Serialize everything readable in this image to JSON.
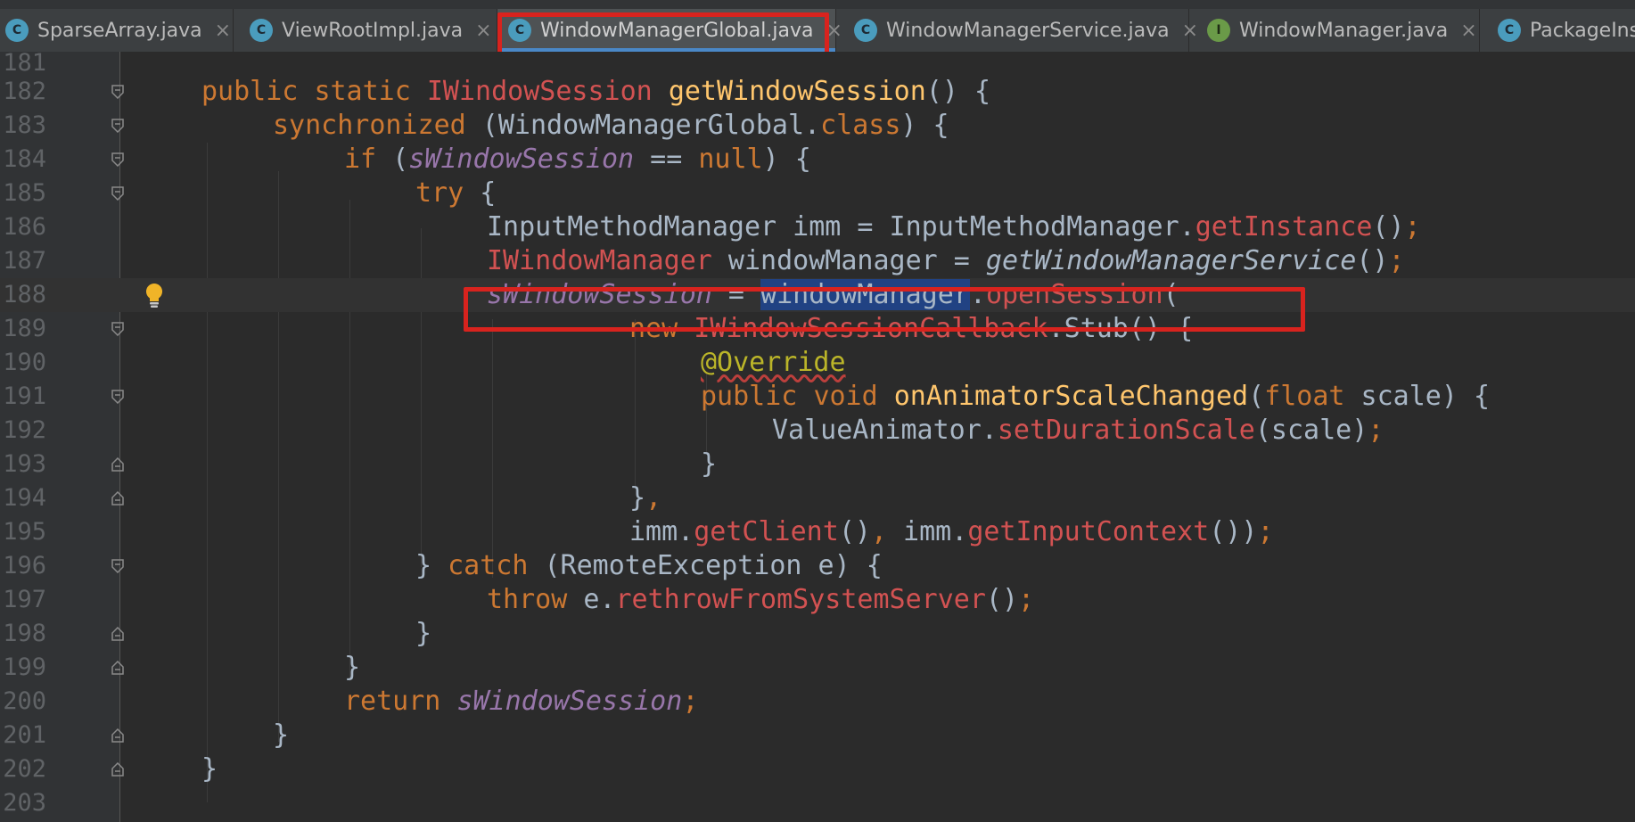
{
  "tabs": [
    {
      "label": "SparseArray.java",
      "icon": "class-icon",
      "active": false
    },
    {
      "label": "ViewRootImpl.java",
      "icon": "class-icon",
      "active": false
    },
    {
      "label": "WindowManagerGlobal.java",
      "icon": "class-icon",
      "active": true
    },
    {
      "label": "WindowManagerService.java",
      "icon": "class-icon",
      "active": false
    },
    {
      "label": "WindowManager.java",
      "icon": "interface-icon",
      "active": false
    },
    {
      "label": "PackageIns",
      "icon": "class-icon",
      "active": false
    }
  ],
  "icon_glyphs": {
    "class": "C",
    "interface": "I"
  },
  "close_glyph": "×",
  "line_numbers": [
    "181",
    "182",
    "183",
    "184",
    "185",
    "186",
    "187",
    "188",
    "189",
    "190",
    "191",
    "192",
    "193",
    "194",
    "195",
    "196",
    "197",
    "198",
    "199",
    "200",
    "201",
    "202",
    "203"
  ],
  "current_line": "188",
  "code": {
    "l182": [
      "public",
      " ",
      "static",
      " ",
      "IWindowSession",
      " ",
      "getWindowSession",
      "() {"
    ],
    "l183": [
      "synchronized",
      " (WindowManagerGlobal.",
      "class",
      ") {"
    ],
    "l184": [
      "if",
      " (",
      "sWindowSession",
      " == ",
      "null",
      ") {"
    ],
    "l185": [
      "try",
      " {"
    ],
    "l186": [
      "InputMethodManager imm = InputMethodManager.",
      "getInstance",
      "()",
      ";"
    ],
    "l187": [
      "IWindowManager",
      " windowManager = ",
      "getWindowManagerService",
      "()",
      ";"
    ],
    "l188": [
      "sWindowSession",
      " = ",
      "windowManager",
      ".",
      "openSession",
      "("
    ],
    "l189": [
      "new",
      " ",
      "IWindowSessionCallback",
      ".Stub() {"
    ],
    "l190": [
      "@Override"
    ],
    "l191": [
      "public",
      " ",
      "void",
      " ",
      "onAnimatorScaleChanged",
      "(",
      "float",
      " scale) {"
    ],
    "l192": [
      "ValueAnimator.",
      "setDurationScale",
      "(scale)",
      ";"
    ],
    "l193": [
      "}"
    ],
    "l194": [
      "}",
      ","
    ],
    "l195": [
      "imm.",
      "getClient",
      "()",
      ",",
      " imm.",
      "getInputContext",
      "())",
      ";"
    ],
    "l196": [
      "}",
      " ",
      "catch",
      " (RemoteException e) {"
    ],
    "l197": [
      "throw",
      " e.",
      "rethrowFromSystemServer",
      "()",
      ";"
    ],
    "l198": [
      "}"
    ],
    "l199": [
      "}"
    ],
    "l200": [
      "return",
      " ",
      "sWindowSession",
      ";"
    ],
    "l201": [
      "}"
    ],
    "l202": [
      "}"
    ]
  },
  "colors": {
    "keyword": "#cc7832",
    "method": "#ffc66d",
    "field": "#9876aa",
    "error": "#d25252",
    "annotation": "#bbb529",
    "plain": "#a9b7c6",
    "selection": "#214283",
    "highlight_box": "#d8231e",
    "tab_accent": "#4a88c7"
  }
}
